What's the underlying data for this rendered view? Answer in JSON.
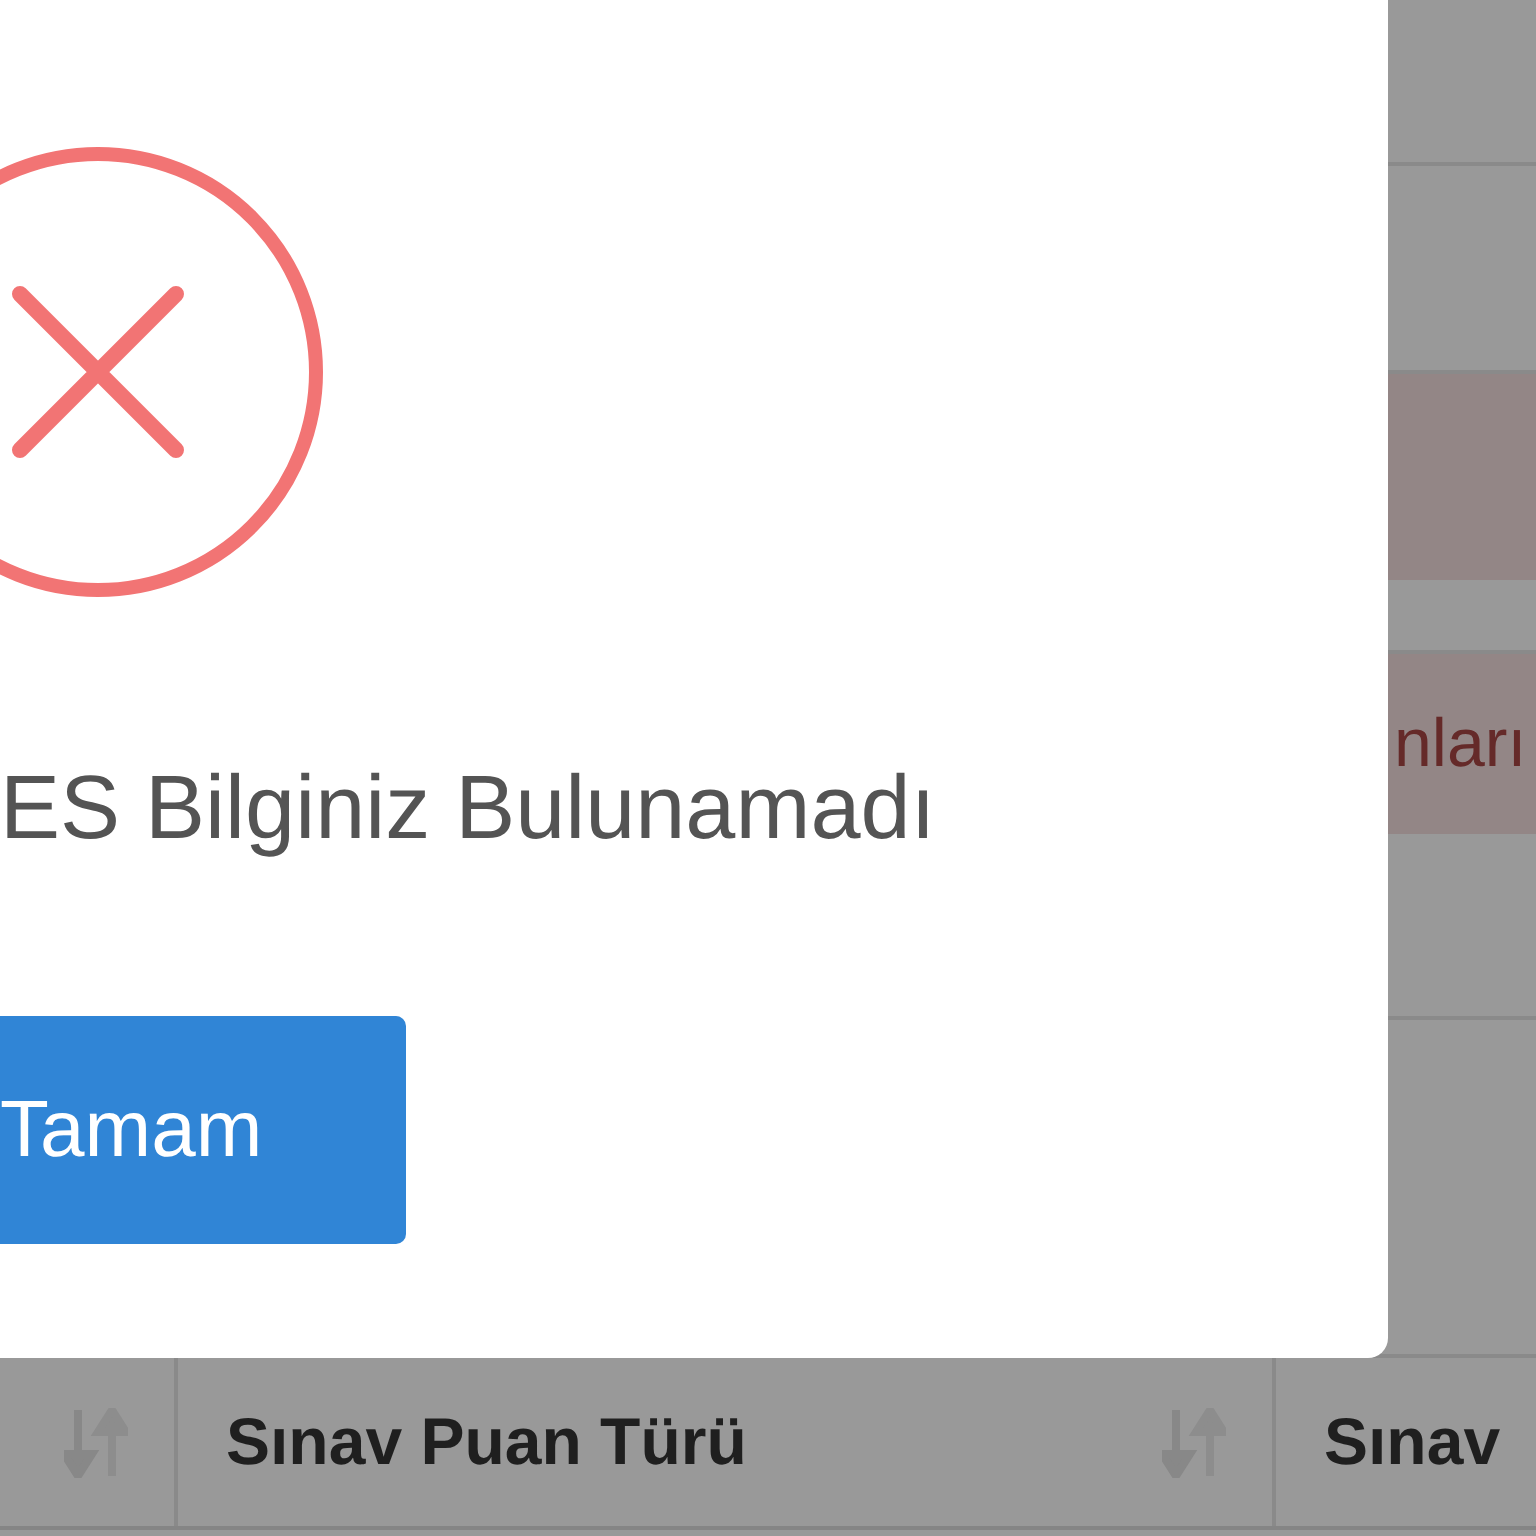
{
  "dialog": {
    "kind": "error",
    "message": "ES Bilginiz Bulunamadı",
    "confirm_button": "Tamam"
  },
  "page": {
    "sections": [
      {
        "kind": "row"
      },
      {
        "kind": "row"
      },
      {
        "kind": "alert"
      },
      {
        "kind": "row"
      },
      {
        "kind": "alert",
        "text": "nları"
      },
      {
        "kind": "row"
      },
      {
        "kind": "row"
      }
    ]
  },
  "table": {
    "columns": [
      {
        "sortable": true
      },
      {
        "label": "Sınav Puan Türü",
        "sortable": true
      },
      {
        "label": "Sınav",
        "sortable": false
      }
    ]
  }
}
